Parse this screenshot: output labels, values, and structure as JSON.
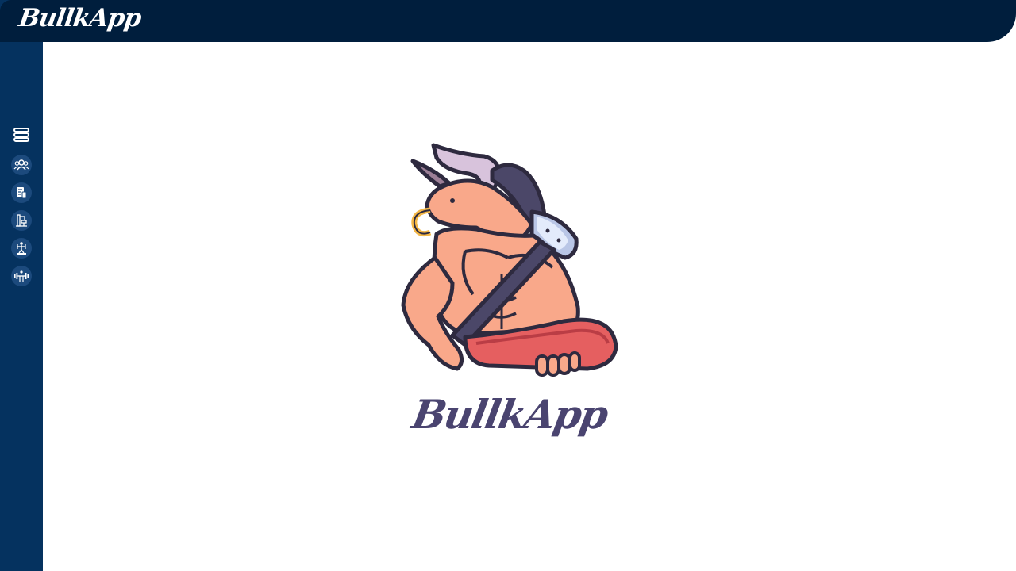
{
  "app": {
    "brand": "BullkApp"
  },
  "hero": {
    "title": "BullkApp"
  },
  "sidebar": {
    "items": [
      {
        "icon": "menu-icon"
      },
      {
        "icon": "users-icon"
      },
      {
        "icon": "document-icon"
      },
      {
        "icon": "gym-machine-icon"
      },
      {
        "icon": "exercise-icon"
      },
      {
        "icon": "dumbbell-icon"
      }
    ]
  },
  "colors": {
    "topbar": "#001e3d",
    "sidebar": "#05325f",
    "nav_button": "#1c4a7d",
    "hero_title": "#4a4470"
  }
}
